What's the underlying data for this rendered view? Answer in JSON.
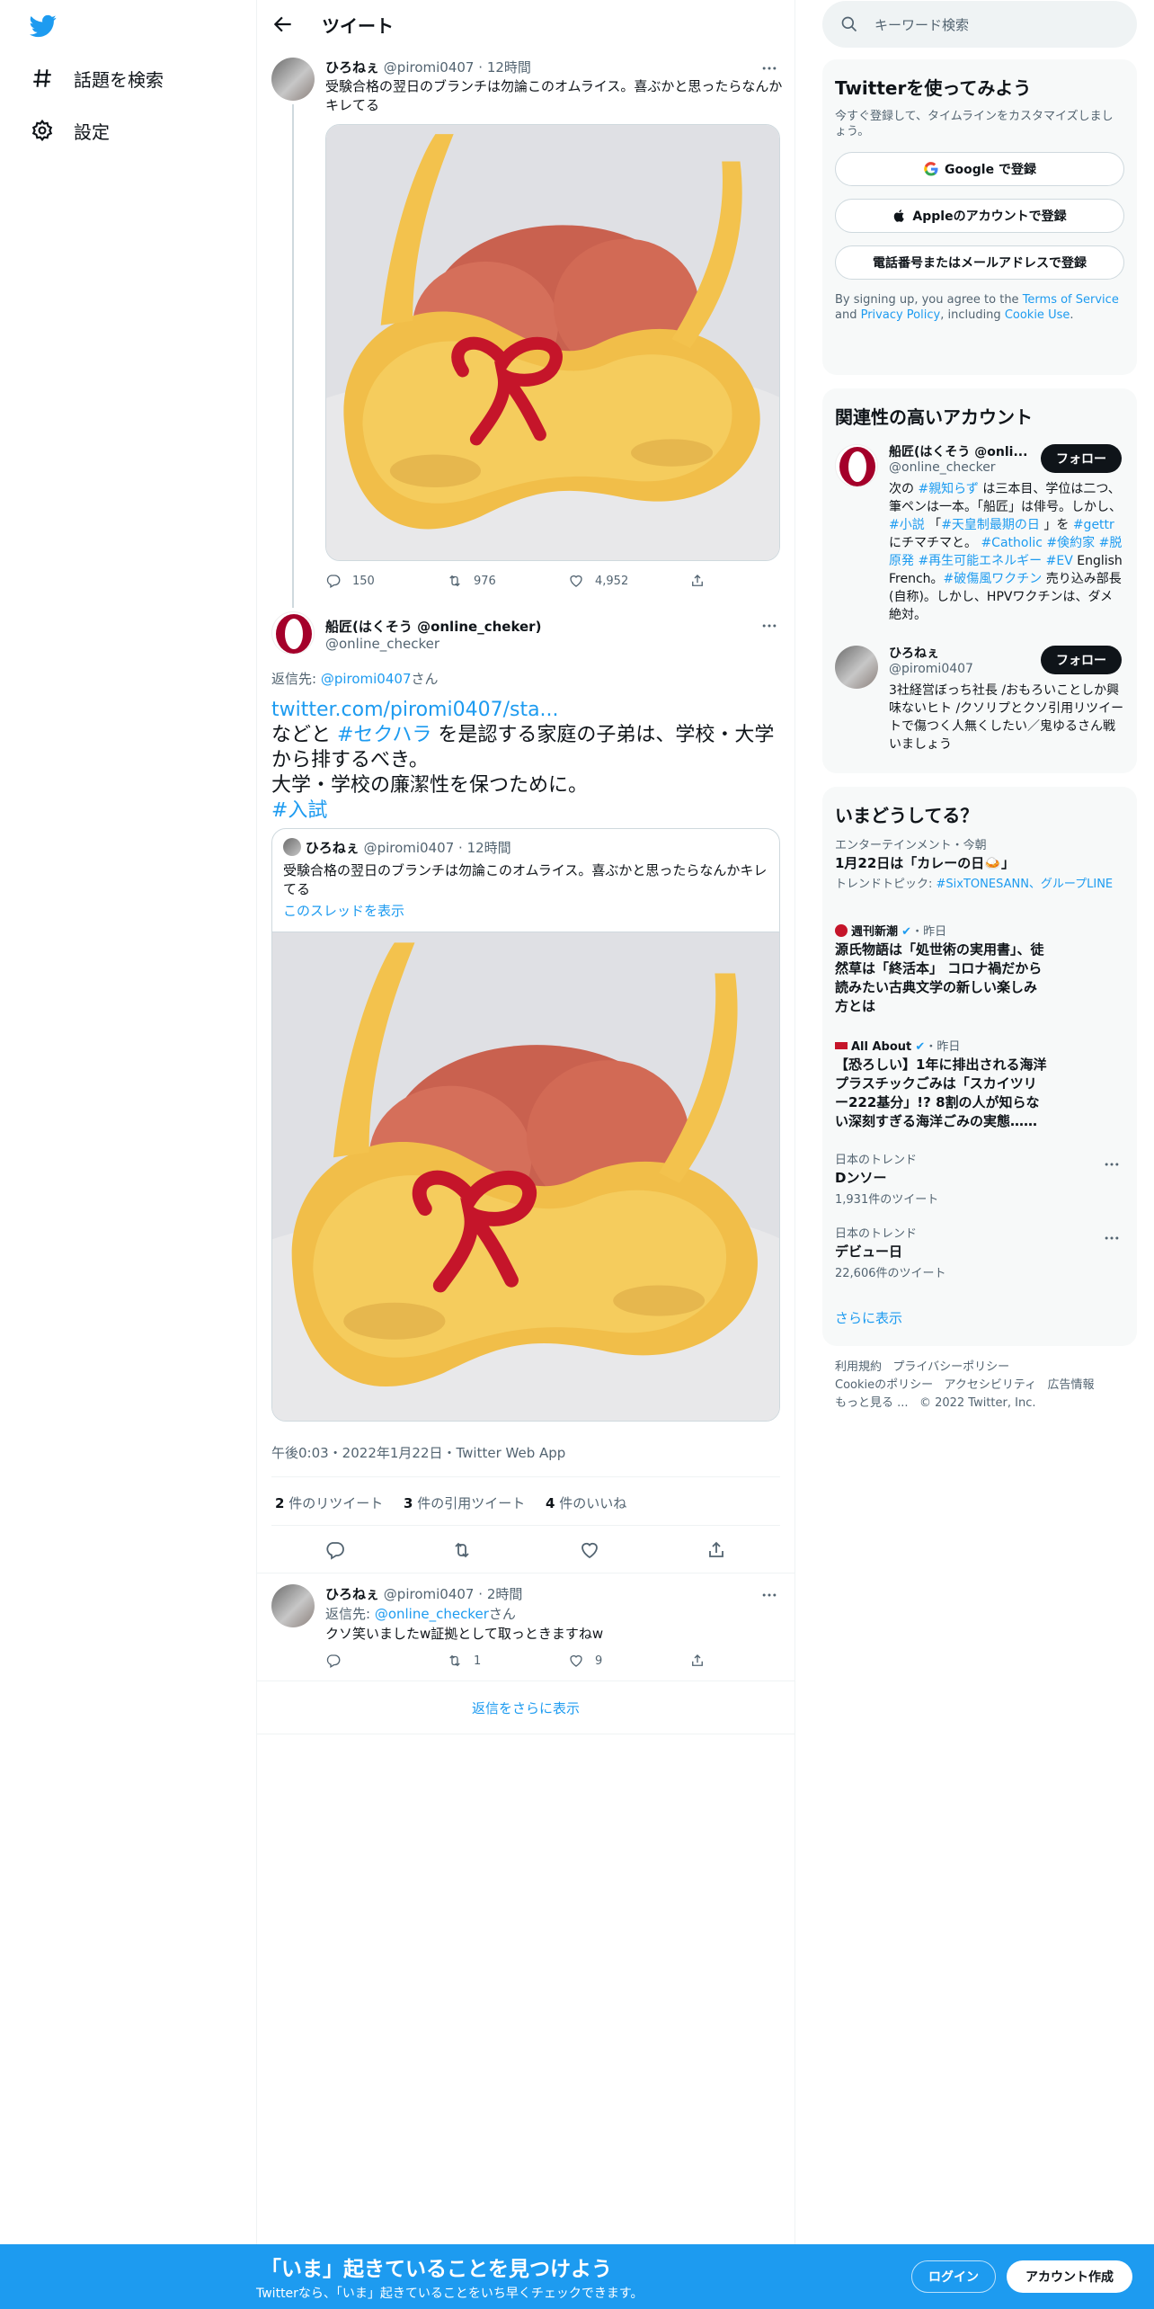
{
  "nav": {
    "items": [
      {
        "label": "話題を検索"
      },
      {
        "label": "設定"
      }
    ]
  },
  "header": {
    "title": "ツイート"
  },
  "parent_tweet": {
    "name": "ひろねぇ",
    "handle": "@piromi0407",
    "time": "12時間",
    "text": "受験合格の翌日のブランチは勿論このオムライス。喜ぶかと思ったらなんかキレてる",
    "replies": "150",
    "retweets": "976",
    "likes": "4,952"
  },
  "main_tweet": {
    "name": "船匠(はくそう @online_cheker)",
    "handle": "@online_checker",
    "reply_prefix": "返信先: ",
    "reply_to": "@piromi0407",
    "reply_suffix": "さん",
    "link": "twitter.com/piromi0407/sta...",
    "text_1": " などと ",
    "hashtag_1": "#セクハラ",
    "text_2": " を是認する家庭の子弟は、学校・大学から排するべき。",
    "text_3": "大学・学校の廉潔性を保つために。",
    "hashtag_2": "#入試",
    "quote": {
      "name": "ひろねぇ",
      "handle": "@piromi0407",
      "time": "12時間",
      "text": "受験合格の翌日のブランチは勿論このオムライス。喜ぶかと思ったらなんかキレてる",
      "thread_link": "このスレッドを表示"
    },
    "timestamp": "午後0:03・2022年1月22日・Twitter Web App",
    "stats": {
      "retweets_count": "2",
      "retweets_label": " 件のリツイート",
      "quotes_count": "3",
      "quotes_label": " 件の引用ツイート",
      "likes_count": "4",
      "likes_label": " 件のいいね"
    }
  },
  "reply_tweet": {
    "name": "ひろねぇ",
    "handle": "@piromi0407",
    "time": "2時間",
    "reply_prefix": "返信先: ",
    "reply_to": "@online_checker",
    "reply_suffix": "さん",
    "text": "クソ笑いましたw証拠として取っときますねw",
    "retweets": "1",
    "likes": "9"
  },
  "show_more_replies": "返信をさらに表示",
  "sidebar": {
    "search_placeholder": "キーワード検索",
    "signup": {
      "title": "Twitterを使ってみよう",
      "subtitle": "今すぐ登録して、タイムラインをカスタマイズしましょう。",
      "google": "Google で登録",
      "apple": "Appleのアカウントで登録",
      "phone": "電話番号またはメールアドレスで登録",
      "terms_1": "By signing up, you agree to the ",
      "terms_link": "Terms of Service",
      "terms_2": " and ",
      "privacy_link": "Privacy Policy",
      "terms_3": ", including ",
      "cookie_link": "Cookie Use",
      "terms_4": "."
    },
    "related": {
      "title": "関連性の高いアカウント",
      "accounts": [
        {
          "name": "船匠(はくそう @onli...",
          "handle": "@online_checker",
          "follow": "フォロー"
        },
        {
          "name": "ひろねぇ",
          "handle": "@piromi0407",
          "follow": "フォロー",
          "bio": "3社経営ぼっち社長 /おもろいことしか興味ないヒト /クソリプとクソ引用リツイートで傷つく人無くしたい／鬼ゆるさん戦いましょう"
        }
      ],
      "bio1": {
        "t1": "次の ",
        "h1": "#親知らず",
        "t2": " は三本目、学位は二つ、筆ペンは一本。「船匠」は俳号。しかし、",
        "h2": "#小説",
        "t3": " 「",
        "h3": "#天皇制最期の日",
        "t4": " 」を ",
        "h4": "#gettr",
        "t5": " にチマチマと。 ",
        "h5": "#Catholic",
        "t6": " ",
        "h6": "#倹約家",
        "t7": " ",
        "h7": "#脱原発",
        "t8": " ",
        "h8": "#再生可能エネルギー",
        "t9": " ",
        "h9": "#EV",
        "t10": " English French。",
        "h10": "#破傷風ワクチン",
        "t11": " 売り込み部長(自称)。しかし、HPVワクチンは、ダメ絶対。"
      }
    },
    "trends": {
      "title": "いまどうしてる？",
      "items": [
        {
          "meta": "エンターテインメント・今朝",
          "title": "1月22日は「カレーの日🍛」",
          "sub_prefix": "トレンドトピック: ",
          "sub_tags": "#SixTONESANN、グループLINE"
        },
        {
          "source": "週刊新潮",
          "meta": "・昨日",
          "title": "源氏物語は「処世術の実用書」、徒然草は「終活本」 コロナ禍だから読みたい古典文学の新しい楽しみ方とは"
        },
        {
          "source": "All About",
          "meta": "・昨日",
          "title": "【恐ろしい】1年に排出される海洋プラスチックごみは「スカイツリー222基分」!? 8割の人が知らない深刻すぎる海洋ごみの実態……"
        },
        {
          "meta": "日本のトレンド",
          "title": "Dンソー",
          "count": "1,931件のツイート"
        },
        {
          "meta": "日本のトレンド",
          "title": "デビュー日",
          "count": "22,606件のツイート"
        }
      ],
      "show_more": "さらに表示"
    },
    "footer": {
      "links": [
        "利用規約",
        "プライバシーポリシー",
        "Cookieのポリシー",
        "アクセシビリティ",
        "広告情報",
        "もっと見る ..."
      ],
      "copyright": "© 2022 Twitter, Inc."
    }
  },
  "bottom_bar": {
    "title": "「いま」起きていることを見つけよう",
    "subtitle": "Twitterなら、「いま」起きていることをいち早くチェックできます。",
    "login": "ログイン",
    "signup": "アカウント作成"
  },
  "colors": {
    "accent": "#1d9bf0",
    "text": "#0f1419",
    "muted": "#536471",
    "border": "#eff3f4",
    "card_bg": "#f7f9f9"
  }
}
